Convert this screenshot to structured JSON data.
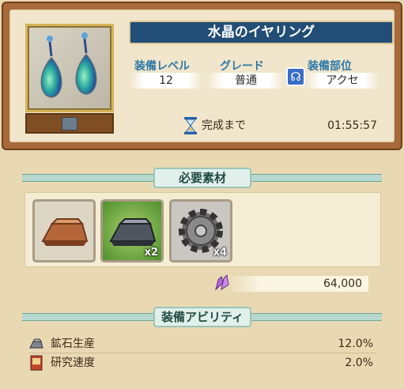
{
  "item": {
    "name": "水晶のイヤリング",
    "icon": "crystal-earrings-icon"
  },
  "stats": [
    {
      "label": "装備レベル",
      "value": "12"
    },
    {
      "label": "グレード",
      "value": "普通"
    },
    {
      "label": "装備部位",
      "value": "アクセ",
      "icon": "accessory-slot-icon"
    }
  ],
  "timer": {
    "label": "完成まで",
    "value": "01:55:57"
  },
  "materials_section": {
    "title": "必要素材",
    "items": [
      {
        "name": "copper-ingot-icon",
        "count": ""
      },
      {
        "name": "iron-ingot-icon",
        "count": "x2"
      },
      {
        "name": "gear-icon",
        "count": "x4"
      }
    ],
    "cost": "64,000"
  },
  "abilities_section": {
    "title": "装備アビリティ",
    "items": [
      {
        "name": "鉱石生産",
        "value": "12.0%",
        "icon": "ore-icon"
      },
      {
        "name": "研究速度",
        "value": "2.0%",
        "icon": "book-icon"
      }
    ]
  }
}
